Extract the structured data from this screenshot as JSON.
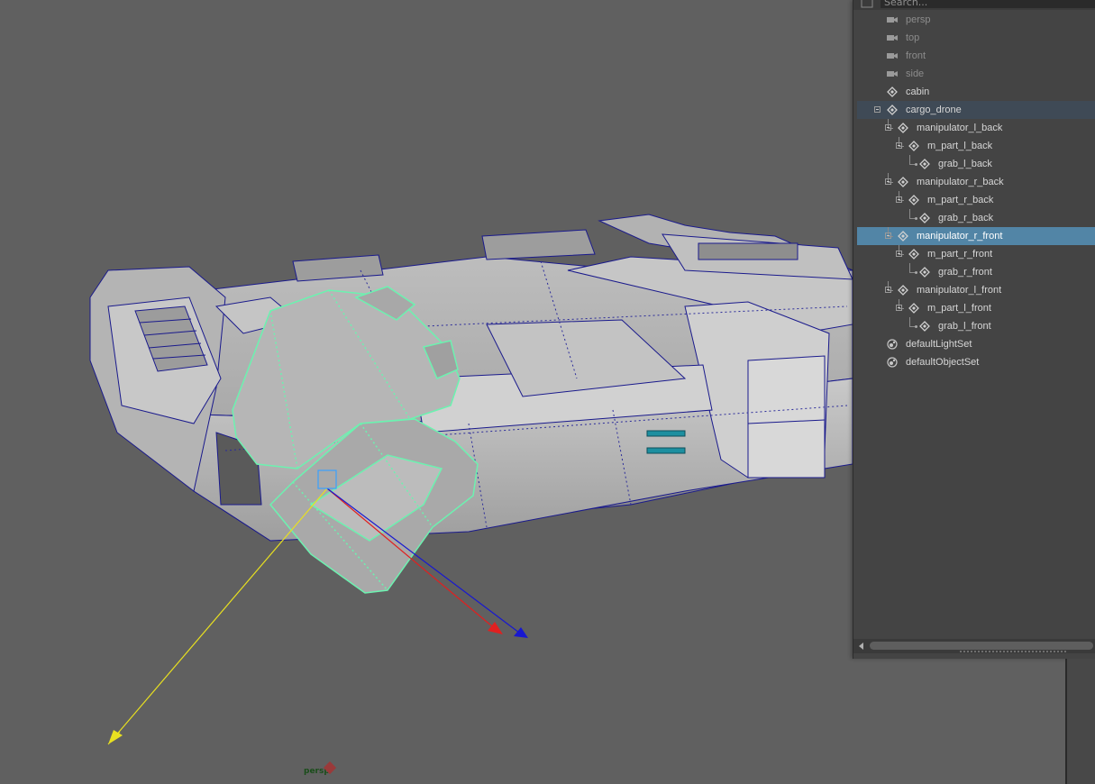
{
  "viewport": {
    "camera_label": "persp",
    "selection_color": "#6cf2b0",
    "wire_color": "#1a1a8c",
    "axis_colors": {
      "x": "#e02020",
      "y": "#e8e020",
      "z": "#1818d0"
    }
  },
  "outliner": {
    "search_placeholder": "Search...",
    "items": [
      {
        "label": "persp",
        "icon": "camera-icon",
        "dim": true
      },
      {
        "label": "top",
        "icon": "camera-icon",
        "dim": true
      },
      {
        "label": "front",
        "icon": "camera-icon",
        "dim": true
      },
      {
        "label": "side",
        "icon": "camera-icon",
        "dim": true
      },
      {
        "label": "cabin",
        "icon": "transform-icon"
      },
      {
        "label": "cargo_drone",
        "icon": "transform-icon",
        "expanded": true
      },
      {
        "label": "manipulator_l_back",
        "icon": "transform-icon",
        "expanded": true
      },
      {
        "label": "m_part_l_back",
        "icon": "transform-icon",
        "expanded": true
      },
      {
        "label": "grab_l_back",
        "icon": "transform-icon"
      },
      {
        "label": "manipulator_r_back",
        "icon": "transform-icon",
        "expanded": true
      },
      {
        "label": "m_part_r_back",
        "icon": "transform-icon",
        "expanded": true
      },
      {
        "label": "grab_r_back",
        "icon": "transform-icon"
      },
      {
        "label": "manipulator_r_front",
        "icon": "transform-icon",
        "expanded": true,
        "selected": true
      },
      {
        "label": "m_part_r_front",
        "icon": "transform-icon",
        "expanded": true
      },
      {
        "label": "grab_r_front",
        "icon": "transform-icon"
      },
      {
        "label": "manipulator_l_front",
        "icon": "transform-icon",
        "expanded": true
      },
      {
        "label": "m_part_l_front",
        "icon": "transform-icon",
        "expanded": true
      },
      {
        "label": "grab_l_front",
        "icon": "transform-icon"
      },
      {
        "label": "defaultLightSet",
        "icon": "set-icon"
      },
      {
        "label": "defaultObjectSet",
        "icon": "set-icon"
      }
    ],
    "selected_color": "#5285a6"
  }
}
